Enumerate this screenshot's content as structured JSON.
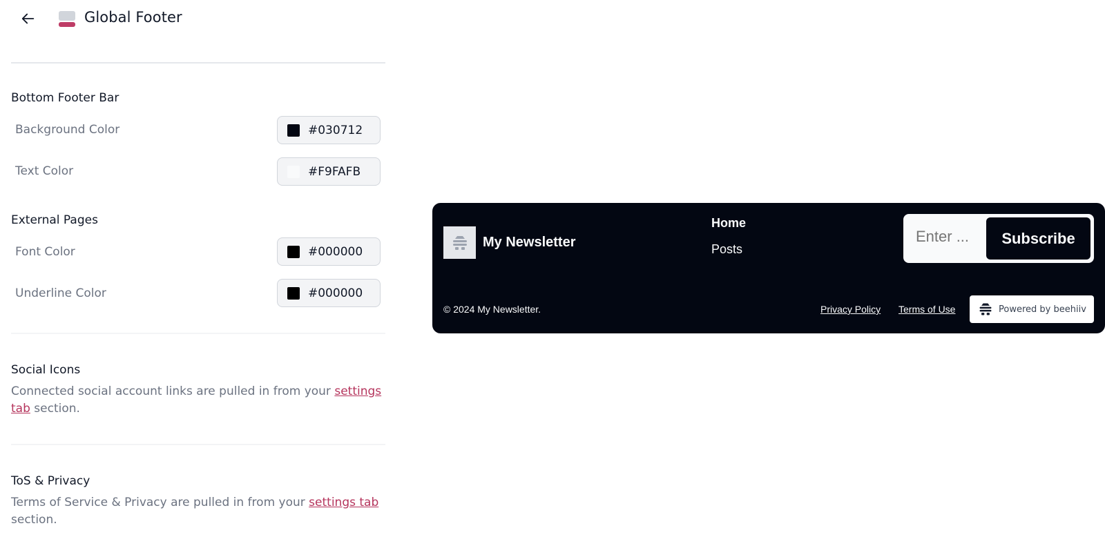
{
  "header": {
    "title": "Global Footer",
    "back_icon": "arrow-left-icon",
    "section_icon": "footer-layout-icon"
  },
  "bottom_footer_bar": {
    "title": "Bottom Footer Bar",
    "rows": [
      {
        "label": "Background Color",
        "value": "#030712",
        "swatch": "#030712"
      },
      {
        "label": "Text Color",
        "value": "#F9FAFB",
        "swatch": "#F9FAFB"
      }
    ]
  },
  "external_pages": {
    "title": "External Pages",
    "rows": [
      {
        "label": "Font Color",
        "value": "#000000",
        "swatch": "#000000"
      },
      {
        "label": "Underline Color",
        "value": "#000000",
        "swatch": "#000000"
      }
    ]
  },
  "social_icons": {
    "title": "Social Icons",
    "desc_before": "Connected social account links are pulled in from your ",
    "link": "settings tab",
    "desc_after": " section."
  },
  "tos_privacy": {
    "title": "ToS & Privacy",
    "desc_before": "Terms of Service & Privacy are pulled in from your ",
    "link": "settings tab",
    "desc_after": " section."
  },
  "preview": {
    "brand": "My Newsletter",
    "logo_icon": "beehive-icon",
    "nav": [
      "Home",
      "Posts"
    ],
    "subscribe_placeholder": "Enter ...",
    "subscribe_button": "Subscribe",
    "copyright": "© 2024 My Newsletter.",
    "privacy_link": "Privacy Policy",
    "terms_link": "Terms of Use",
    "powered_by": "Powered by beehiiv"
  },
  "colors": {
    "accent": "#B5345C",
    "footer_bg": "#030712",
    "footer_text": "#F9FAFB"
  }
}
